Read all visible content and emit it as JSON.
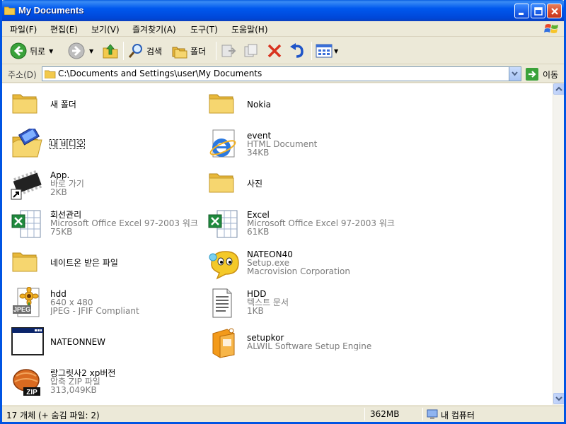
{
  "window": {
    "title": "My Documents"
  },
  "menu": [
    "파일(F)",
    "편집(E)",
    "보기(V)",
    "즐겨찾기(A)",
    "도구(T)",
    "도움말(H)"
  ],
  "toolbar": {
    "back": "뒤로",
    "search": "검색",
    "folders": "폴더"
  },
  "address": {
    "label": "주소(D)",
    "value": "C:\\Documents and Settings\\user\\My Documents",
    "go": "이동"
  },
  "items": [
    {
      "name": "새 폴더",
      "icon": "folder-icon"
    },
    {
      "name": "Nokia",
      "icon": "folder-icon"
    },
    {
      "name": "내 비디오",
      "icon": "video-folder-icon"
    },
    {
      "name": "event",
      "type": "HTML Document",
      "size": "34KB",
      "icon": "ie-document-icon"
    },
    {
      "name": "App.",
      "type": "바로 가기",
      "size": "2KB",
      "icon": "chip-shortcut-icon"
    },
    {
      "name": "사진",
      "icon": "folder-icon"
    },
    {
      "name": "회선관리",
      "type": "Microsoft Office Excel 97-2003 워크...",
      "size": "75KB",
      "icon": "excel-icon"
    },
    {
      "name": "Excel",
      "type": "Microsoft Office Excel 97-2003 워크...",
      "size": "61KB",
      "icon": "excel-icon"
    },
    {
      "name": "네이트온 받은 파일",
      "icon": "folder-icon"
    },
    {
      "name": "NATEON40",
      "type": "Setup.exe",
      "size": "Macrovision Corporation",
      "icon": "nateon-icon"
    },
    {
      "name": "hdd",
      "type": "640 x 480",
      "size": "JPEG - JFIF Compliant",
      "icon": "jpeg-icon"
    },
    {
      "name": "HDD",
      "type": "텍스트 문서",
      "size": "1KB",
      "icon": "text-document-icon"
    },
    {
      "name": "NATEONNEW",
      "icon": "app-window-icon"
    },
    {
      "name": "setupkor",
      "type": "ALWIL Software Setup Engine",
      "icon": "setup-box-icon"
    },
    {
      "name": "랑그릿사2 xp버전",
      "type": "압축 ZIP 파일",
      "size": "313,049KB",
      "icon": "zip-icon"
    }
  ],
  "status": {
    "count": "17 개체 (+ 숨김 파일: 2)",
    "size": "362MB",
    "location": "내 컴퓨터"
  },
  "colors": {
    "titlebar": "#0058ee",
    "folder": "#f6d66f",
    "window_bg": "#ece9d8"
  }
}
